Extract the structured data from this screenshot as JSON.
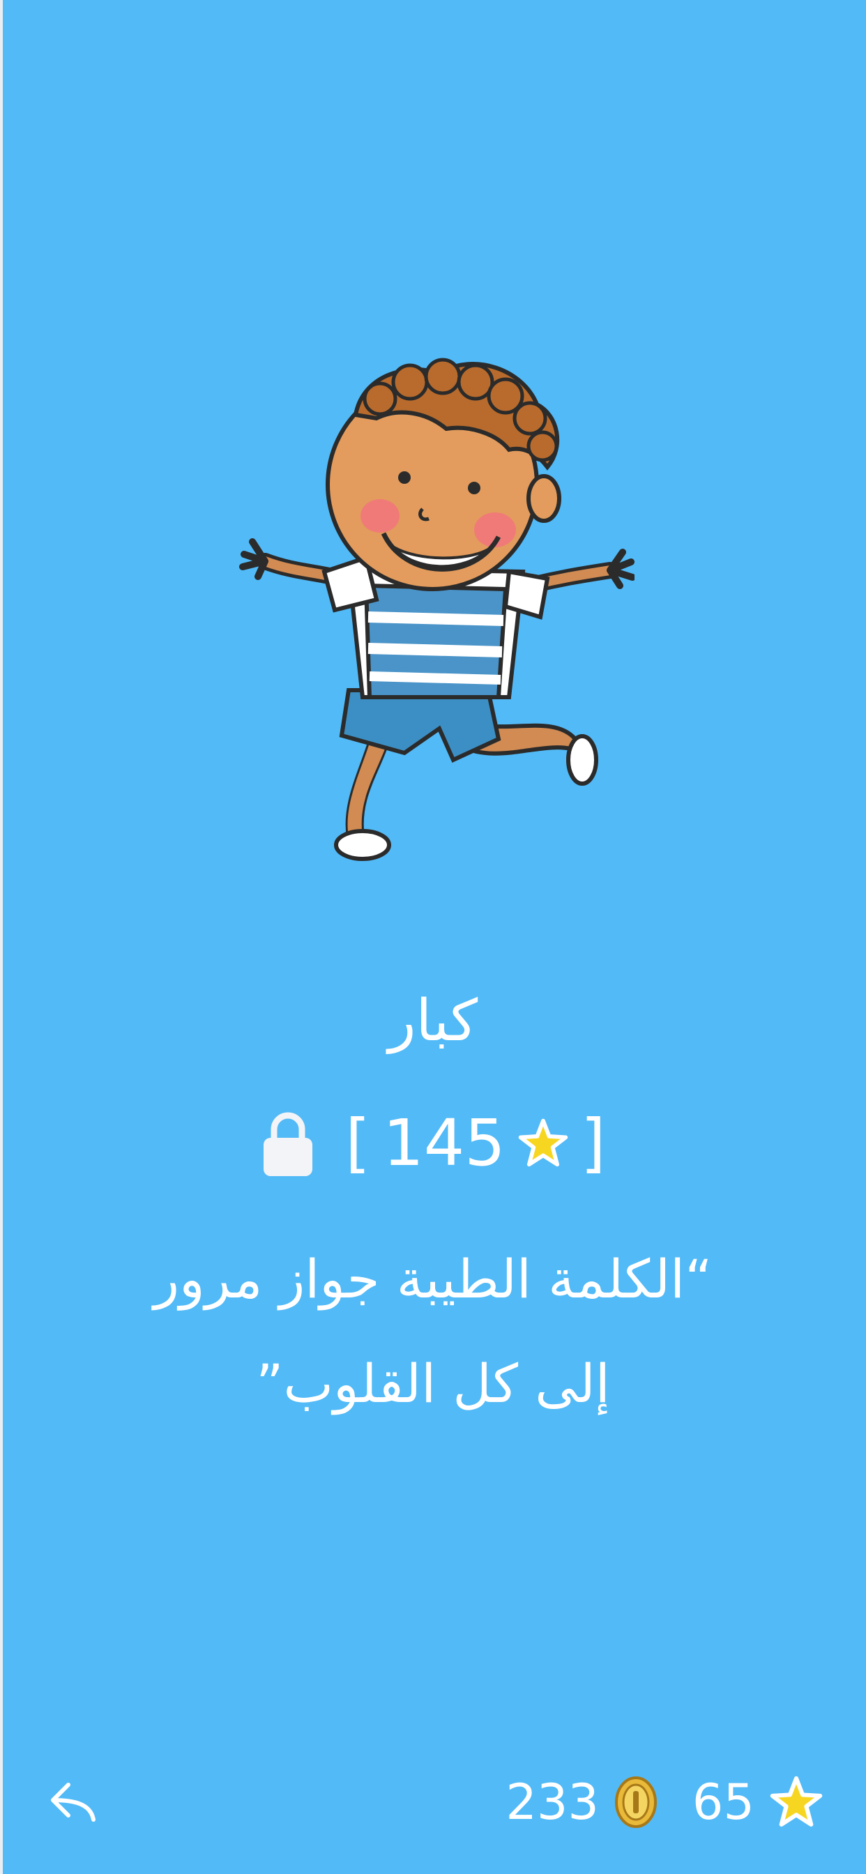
{
  "level": {
    "title": "كبار",
    "required_stars": "145",
    "bracket_open": "[",
    "bracket_close": "]",
    "locked": true,
    "quote_line1": "“الكلمة الطيبة جواز مرور",
    "quote_line2": "إلى كل القلوب”"
  },
  "stats": {
    "coins": "233",
    "stars": "65"
  },
  "icons": {
    "back": "reply-arrow-icon",
    "lock": "lock-icon",
    "coin": "coin-icon",
    "star": "star-icon"
  },
  "colors": {
    "background": "#52baf7",
    "text": "#ffffff",
    "star": "#f7d622",
    "coin": "#e9b93a"
  }
}
